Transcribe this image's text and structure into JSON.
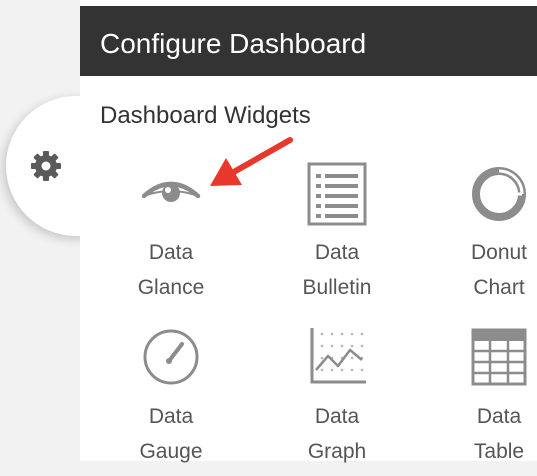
{
  "panel": {
    "title": "Configure Dashboard",
    "section_title": "Dashboard Widgets"
  },
  "widgets": [
    {
      "line1": "Data",
      "line2": "Glance",
      "icon": "eye-icon"
    },
    {
      "line1": "Data",
      "line2": "Bulletin",
      "icon": "bulletin-list-icon"
    },
    {
      "line1": "Donut",
      "line2": "Chart",
      "icon": "donut-chart-icon"
    },
    {
      "line1": "Data",
      "line2": "Gauge",
      "icon": "gauge-icon"
    },
    {
      "line1": "Data",
      "line2": "Graph",
      "icon": "line-graph-icon"
    },
    {
      "line1": "Data",
      "line2": "Table",
      "icon": "table-icon"
    }
  ],
  "colors": {
    "header_bg": "#333333",
    "icon_gray": "#8c8c8c",
    "annotation_arrow": "#e8382b"
  }
}
